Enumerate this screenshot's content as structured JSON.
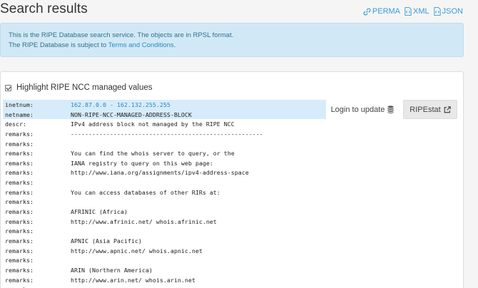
{
  "page": {
    "title": "Search results"
  },
  "format_links": [
    {
      "label": "PERMA",
      "icon": "link-icon"
    },
    {
      "label": "XML",
      "icon": "file-code-icon"
    },
    {
      "label": "JSON",
      "icon": "file-code-icon"
    }
  ],
  "info": {
    "line1": "This is the RIPE Database search service. The objects are in RPSL format.",
    "line2_prefix": "The RIPE Database is subject to ",
    "line2_link": "Terms and Conditions",
    "line2_suffix": "."
  },
  "highlight": {
    "label": "Highlight RIPE NCC managed values",
    "checked": true
  },
  "actions": {
    "login_label": "Login to update",
    "login_icon": "database-icon",
    "ripestat_label": "RIPEstat",
    "ripestat_icon": "external-link-icon"
  },
  "whois": [
    {
      "key": "inetnum:",
      "value": "162.87.0.0 - 162.132.255.255",
      "style": "blue"
    },
    {
      "key": "netname:",
      "value": "NON-RIPE-NCC-MANAGED-ADDRESS-BLOCK",
      "style": "dark"
    },
    {
      "key": "descr:",
      "value": "IPv4 address block not managed by the RIPE NCC",
      "style": ""
    },
    {
      "key": "remarks:",
      "value": "------------------------------------------------------",
      "style": ""
    },
    {
      "key": "remarks:",
      "value": "",
      "style": ""
    },
    {
      "key": "remarks:",
      "value": "You can find the whois server to query, or the",
      "style": ""
    },
    {
      "key": "remarks:",
      "value": "IANA registry to query on this web page:",
      "style": ""
    },
    {
      "key": "remarks:",
      "value": "http://www.iana.org/assignments/ipv4-address-space",
      "style": ""
    },
    {
      "key": "remarks:",
      "value": "",
      "style": ""
    },
    {
      "key": "remarks:",
      "value": "You can access databases of other RIRs at:",
      "style": ""
    },
    {
      "key": "remarks:",
      "value": "",
      "style": ""
    },
    {
      "key": "remarks:",
      "value": "AFRINIC (Africa)",
      "style": ""
    },
    {
      "key": "remarks:",
      "value": "http://www.afrinic.net/ whois.afrinic.net",
      "style": ""
    },
    {
      "key": "remarks:",
      "value": "",
      "style": ""
    },
    {
      "key": "remarks:",
      "value": "APNIC (Asia Pacific)",
      "style": ""
    },
    {
      "key": "remarks:",
      "value": "http://www.apnic.net/ whois.apnic.net",
      "style": ""
    },
    {
      "key": "remarks:",
      "value": "",
      "style": ""
    },
    {
      "key": "remarks:",
      "value": "ARIN (Northern America)",
      "style": ""
    },
    {
      "key": "remarks:",
      "value": "http://www.arin.net/ whois.arin.net",
      "style": ""
    },
    {
      "key": "remarks:",
      "value": "",
      "style": ""
    }
  ]
}
